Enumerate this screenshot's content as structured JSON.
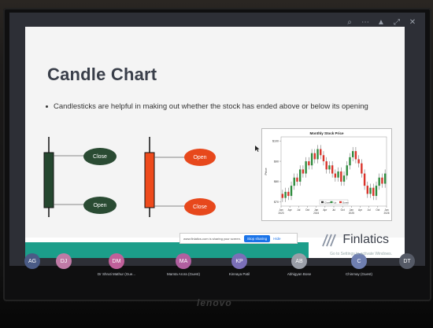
{
  "slide": {
    "title": "Candle Chart",
    "bullet": "Candlesticks are helpful in making out whether the stock has ended above or below its opening",
    "green_candle": {
      "top_label": "Close",
      "bottom_label": "Open"
    },
    "red_candle": {
      "top_label": "Open",
      "bottom_label": "Close"
    },
    "logo_text": "Finlatics"
  },
  "chart_data": {
    "type": "candlestick",
    "title": "Monthly Stock Price",
    "ylabel": "Price",
    "y_ticks": [
      "$100",
      "$90",
      "$80",
      "$70"
    ],
    "x_ticks": [
      "Jan 2023",
      "Apr",
      "Jul",
      "Oct",
      "Jan 2024",
      "Apr",
      "Jul",
      "Oct",
      "Jan 2025",
      "Apr",
      "Jul",
      "Oct",
      "Jan 2026"
    ],
    "ylim": [
      68,
      102
    ],
    "legend": [
      "Close",
      "Up",
      "Down"
    ],
    "values": [
      {
        "o": 74,
        "c": 72
      },
      {
        "o": 72,
        "c": 75
      },
      {
        "o": 75,
        "c": 73
      },
      {
        "o": 73,
        "c": 78
      },
      {
        "o": 78,
        "c": 82
      },
      {
        "o": 82,
        "c": 80
      },
      {
        "o": 80,
        "c": 86
      },
      {
        "o": 86,
        "c": 84
      },
      {
        "o": 84,
        "c": 90
      },
      {
        "o": 90,
        "c": 88
      },
      {
        "o": 88,
        "c": 94
      },
      {
        "o": 94,
        "c": 91
      },
      {
        "o": 91,
        "c": 96
      },
      {
        "o": 96,
        "c": 93
      },
      {
        "o": 93,
        "c": 90
      },
      {
        "o": 90,
        "c": 86
      },
      {
        "o": 86,
        "c": 88
      },
      {
        "o": 88,
        "c": 84
      },
      {
        "o": 84,
        "c": 82
      },
      {
        "o": 82,
        "c": 85
      },
      {
        "o": 85,
        "c": 80
      },
      {
        "o": 80,
        "c": 83
      },
      {
        "o": 83,
        "c": 88
      },
      {
        "o": 88,
        "c": 92
      },
      {
        "o": 92,
        "c": 95
      },
      {
        "o": 95,
        "c": 91
      },
      {
        "o": 91,
        "c": 89
      },
      {
        "o": 89,
        "c": 84
      },
      {
        "o": 84,
        "c": 78
      },
      {
        "o": 78,
        "c": 74
      },
      {
        "o": 74,
        "c": 77
      },
      {
        "o": 77,
        "c": 73
      },
      {
        "o": 73,
        "c": 78
      },
      {
        "o": 78,
        "c": 82
      },
      {
        "o": 82,
        "c": 79
      },
      {
        "o": 79,
        "c": 84
      }
    ],
    "colors": {
      "up": "#2e8b3e",
      "down": "#d9332a"
    }
  },
  "share_bar": {
    "message": "www.finlatics.com is sharing your screen.",
    "stop_label": "Stop sharing",
    "hide_label": "Hide"
  },
  "participants": [
    {
      "initials": "AG",
      "name": "",
      "color": "#4a5b86"
    },
    {
      "initials": "DJ",
      "name": "",
      "color": "#c07aa6"
    },
    {
      "initials": "DM",
      "name": "Dr Shruti Mathur (Gue...",
      "color": "#c0609a"
    },
    {
      "initials": "MA",
      "name": "Mamta Arora (Guest)",
      "color": "#b15fa0"
    },
    {
      "initials": "KP",
      "name": "Kinnaya Patil",
      "color": "#7b6fb8"
    },
    {
      "initials": "AB",
      "name": "Abhigyan Bose",
      "color": "#9b9fa8"
    },
    {
      "initials": "C",
      "name": "Chinmay (Guest)",
      "color": "#6f7fb0"
    },
    {
      "initials": "DT",
      "name": "",
      "color": "#555a66"
    }
  ],
  "windows_watermark": "Go to Settings to activate Windows.",
  "monitor_brand": "lenovo",
  "toolbar_icons": [
    "minimize-icon",
    "window-icon",
    "zoom-icon",
    "more-icon",
    "pin-icon",
    "expand-icon",
    "close-icon"
  ]
}
